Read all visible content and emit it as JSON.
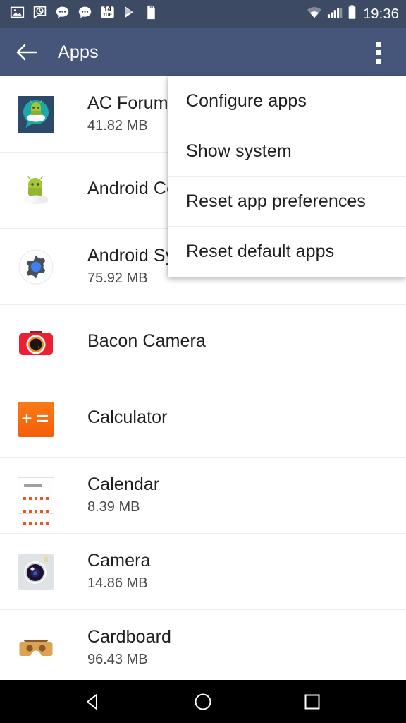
{
  "status_bar": {
    "time": "19:36",
    "left_icons": [
      {
        "name": "photo-icon"
      },
      {
        "name": "clock-message-icon"
      },
      {
        "name": "message-bubble-icon"
      },
      {
        "name": "message-bubble-icon-2"
      },
      {
        "name": "calendar-icon",
        "day_number": "14",
        "day_name": "TUE"
      },
      {
        "name": "play-store-icon"
      },
      {
        "name": "sd-card-icon"
      }
    ],
    "right_icons": [
      {
        "name": "wifi-icon"
      },
      {
        "name": "cellular-signal-icon"
      },
      {
        "name": "battery-icon"
      }
    ]
  },
  "app_bar": {
    "back_label": "back-arrow",
    "title": "Apps",
    "overflow_label": "more-options"
  },
  "overflow_menu": {
    "visible": true,
    "items": [
      {
        "label": "Configure apps"
      },
      {
        "label": "Show system"
      },
      {
        "label": "Reset app preferences"
      },
      {
        "label": "Reset default apps"
      }
    ]
  },
  "app_list": [
    {
      "name": "AC Forums",
      "size": "41.82 MB",
      "icon": "ac-forums-icon"
    },
    {
      "name": "Android Central",
      "size": "",
      "icon": "android-central-icon"
    },
    {
      "name": "Android System",
      "size": "75.92 MB",
      "icon": "android-system-icon"
    },
    {
      "name": "Bacon Camera",
      "size": "",
      "icon": "bacon-camera-icon"
    },
    {
      "name": "Calculator",
      "size": "",
      "icon": "calculator-icon"
    },
    {
      "name": "Calendar",
      "size": "8.39 MB",
      "icon": "calendar-app-icon"
    },
    {
      "name": "Camera",
      "size": "14.86 MB",
      "icon": "camera-icon"
    },
    {
      "name": "Cardboard",
      "size": "96.43 MB",
      "icon": "cardboard-icon"
    }
  ],
  "nav_bar": {
    "back": "back-nav",
    "home": "home-nav",
    "recents": "recents-nav"
  },
  "colors": {
    "status_bar": "#3d4a63",
    "app_bar": "#45567a",
    "accent_orange": "#f4511e",
    "nav_bar": "#000000",
    "divider": "#eceff1"
  }
}
